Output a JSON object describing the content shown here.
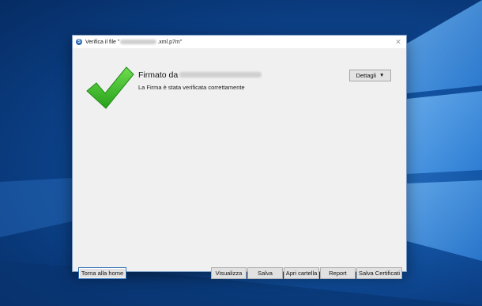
{
  "window": {
    "title_prefix": "Verifica il file \"",
    "title_suffix": ".xml.p7m\"",
    "close_glyph": "✕",
    "app_icon_glyph": "S"
  },
  "signature": {
    "signed_by_label": "Firmato da",
    "status_message": "La Firma è stata verificata correttamente",
    "check_color": "#3db82b"
  },
  "details_button": {
    "label": "Dettagli",
    "icon": "caret-down-icon"
  },
  "footer": {
    "home_label": "Torna alla home",
    "buttons": [
      {
        "label": "Visualizza"
      },
      {
        "label": "Salva"
      },
      {
        "label": "Apri cartella"
      },
      {
        "label": "Report"
      },
      {
        "label": "Salva Certificati"
      }
    ]
  }
}
